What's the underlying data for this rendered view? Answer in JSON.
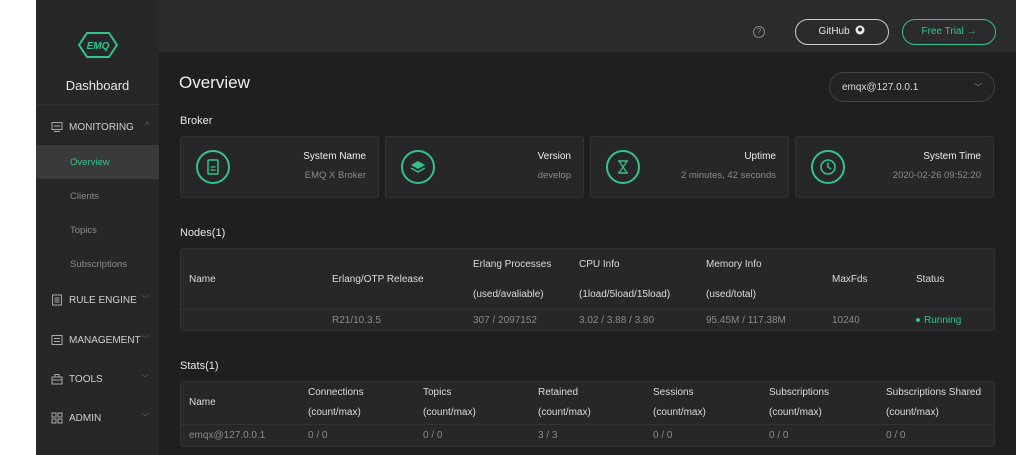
{
  "sidebar": {
    "logo_text": "EMQ",
    "brand": "Dashboard",
    "monitoring": {
      "label": "MONITORING"
    },
    "sub_items": [
      {
        "label": "Overview",
        "active": true
      },
      {
        "label": "Clients"
      },
      {
        "label": "Topics"
      },
      {
        "label": "Subscriptions"
      }
    ],
    "rule_engine": {
      "label": "RULE ENGINE"
    },
    "management": {
      "label": "MANAGEMENT"
    },
    "tools": {
      "label": "TOOLS"
    },
    "admin": {
      "label": "ADMIN"
    }
  },
  "header": {
    "help_icon": "?",
    "github_label": "GitHub",
    "trial_label": "Free Trial →"
  },
  "page": {
    "title": "Overview",
    "node_select": "emqx@127.0.0.1"
  },
  "broker": {
    "heading": "Broker",
    "cards": [
      {
        "icon": "document-icon",
        "title": "System Name",
        "value": "EMQ X Broker"
      },
      {
        "icon": "layers-icon",
        "title": "Version",
        "value": "develop"
      },
      {
        "icon": "hourglass-icon",
        "title": "Uptime",
        "value": "2 minutes, 42 seconds"
      },
      {
        "icon": "clock-icon",
        "title": "System Time",
        "value": "2020-02-26 09:52:20"
      }
    ]
  },
  "nodes": {
    "heading": "Nodes(1)",
    "headers": {
      "name": "Name",
      "otp": "Erlang/OTP Release",
      "proc": "Erlang Processes",
      "proc_sub": "(used/avaliable)",
      "cpu": "CPU Info",
      "cpu_sub": "(1load/5load/15load)",
      "mem": "Memory Info",
      "mem_sub": "(used/total)",
      "maxfds": "MaxFds",
      "status": "Status"
    },
    "row": {
      "name": "",
      "otp": "R21/10.3.5",
      "proc": "307 / 2097152",
      "cpu": "3.02 / 3.88 / 3.80",
      "mem": "95.45M / 117.38M",
      "maxfds": "10240",
      "status": "Running"
    }
  },
  "stats": {
    "heading": "Stats(1)",
    "headers": {
      "name": "Name",
      "connections": "Connections",
      "topics": "Topics",
      "retained": "Retained",
      "sessions": "Sessions",
      "subscriptions": "Subscriptions",
      "subs_shared": "Subscriptions Shared",
      "sub": "(count/max)"
    },
    "row": {
      "name": "emqx@127.0.0.1",
      "connections": "0 / 0",
      "topics": "0 / 0",
      "retained": "3 / 3",
      "sessions": "0 / 0",
      "subscriptions": "0 / 0",
      "subs_shared": "0 / 0"
    }
  },
  "colors": {
    "accent": "#34c388",
    "bg": "#1f1f21",
    "sidebar": "#27272a"
  }
}
